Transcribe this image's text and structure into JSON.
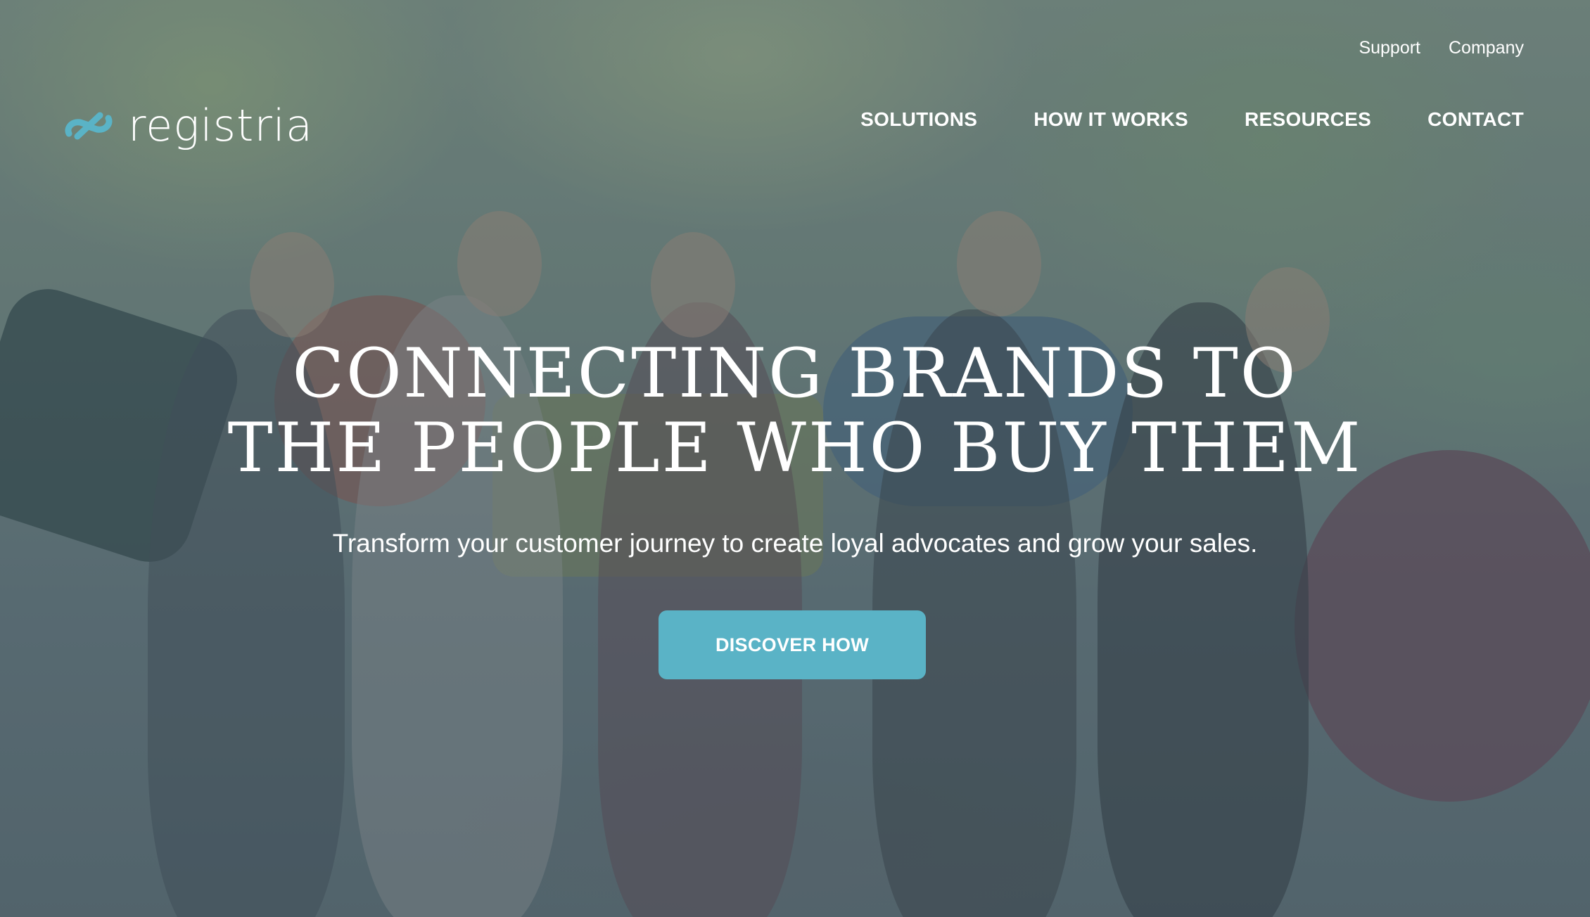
{
  "brand": {
    "name": "registria",
    "icon": "link-icon",
    "accent_color": "#5ab3c6"
  },
  "utility_nav": {
    "support": "Support",
    "company": "Company"
  },
  "main_nav": {
    "solutions": "SOLUTIONS",
    "how_it_works": "HOW IT WORKS",
    "resources": "RESOURCES",
    "contact": "CONTACT"
  },
  "hero": {
    "headline_line1": "CONNECTING BRANDS TO",
    "headline_line2": "THE PEOPLE WHO BUY THEM",
    "subheadline": "Transform your customer journey to create loyal advocates and grow your sales.",
    "cta_label": "DISCOVER HOW",
    "cta_color": "#5ab3c6"
  }
}
